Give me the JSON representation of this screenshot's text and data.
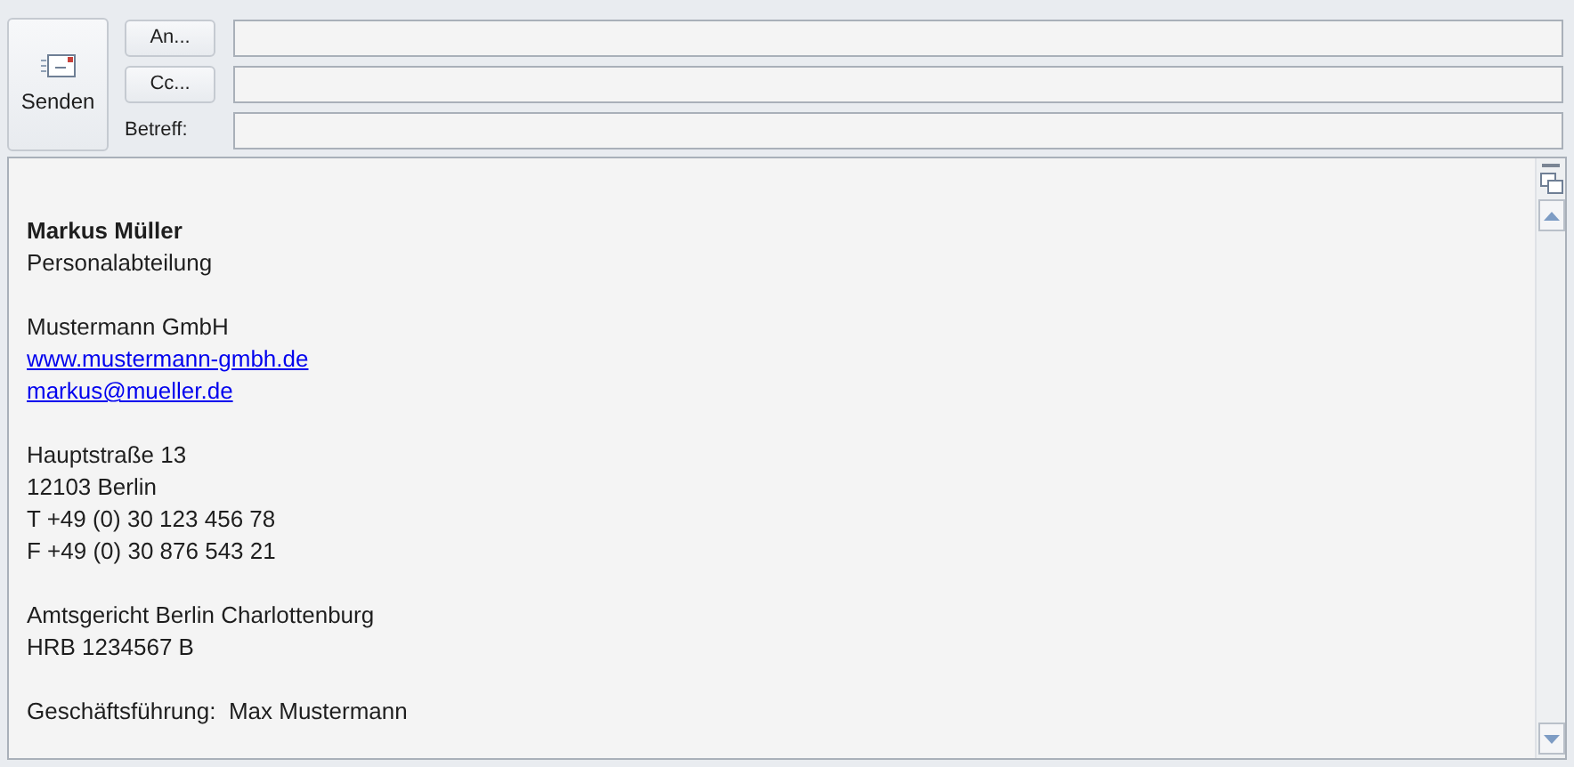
{
  "send_button": {
    "label": "Senden"
  },
  "address_fields": [
    {
      "kind": "button",
      "label": "An..."
    },
    {
      "kind": "button",
      "label": "Cc..."
    },
    {
      "kind": "label",
      "label": "Betreff:"
    }
  ],
  "signature": [
    {
      "lines": [
        {
          "kind": "bold",
          "text": "Markus Müller"
        },
        {
          "kind": "text",
          "text": "Personalabteilung"
        }
      ]
    },
    {
      "lines": [
        {
          "kind": "text",
          "text": "Mustermann GmbH"
        },
        {
          "kind": "link",
          "text": "www.mustermann-gmbh.de"
        },
        {
          "kind": "link",
          "text": "markus@mueller.de"
        }
      ]
    },
    {
      "lines": [
        {
          "kind": "text",
          "text": "Hauptstraße 13"
        },
        {
          "kind": "text",
          "text": "12103 Berlin"
        },
        {
          "kind": "text",
          "text": "T +49 (0) 30 123 456 78"
        },
        {
          "kind": "text",
          "text": "F +49 (0) 30 876 543 21"
        }
      ]
    },
    {
      "lines": [
        {
          "kind": "text",
          "text": "Amtsgericht Berlin Charlottenburg"
        },
        {
          "kind": "text",
          "text": "HRB 1234567 B"
        }
      ]
    },
    {
      "lines": [
        {
          "kind": "text",
          "text": "Geschäftsführung:  Max Mustermann"
        }
      ]
    }
  ]
}
